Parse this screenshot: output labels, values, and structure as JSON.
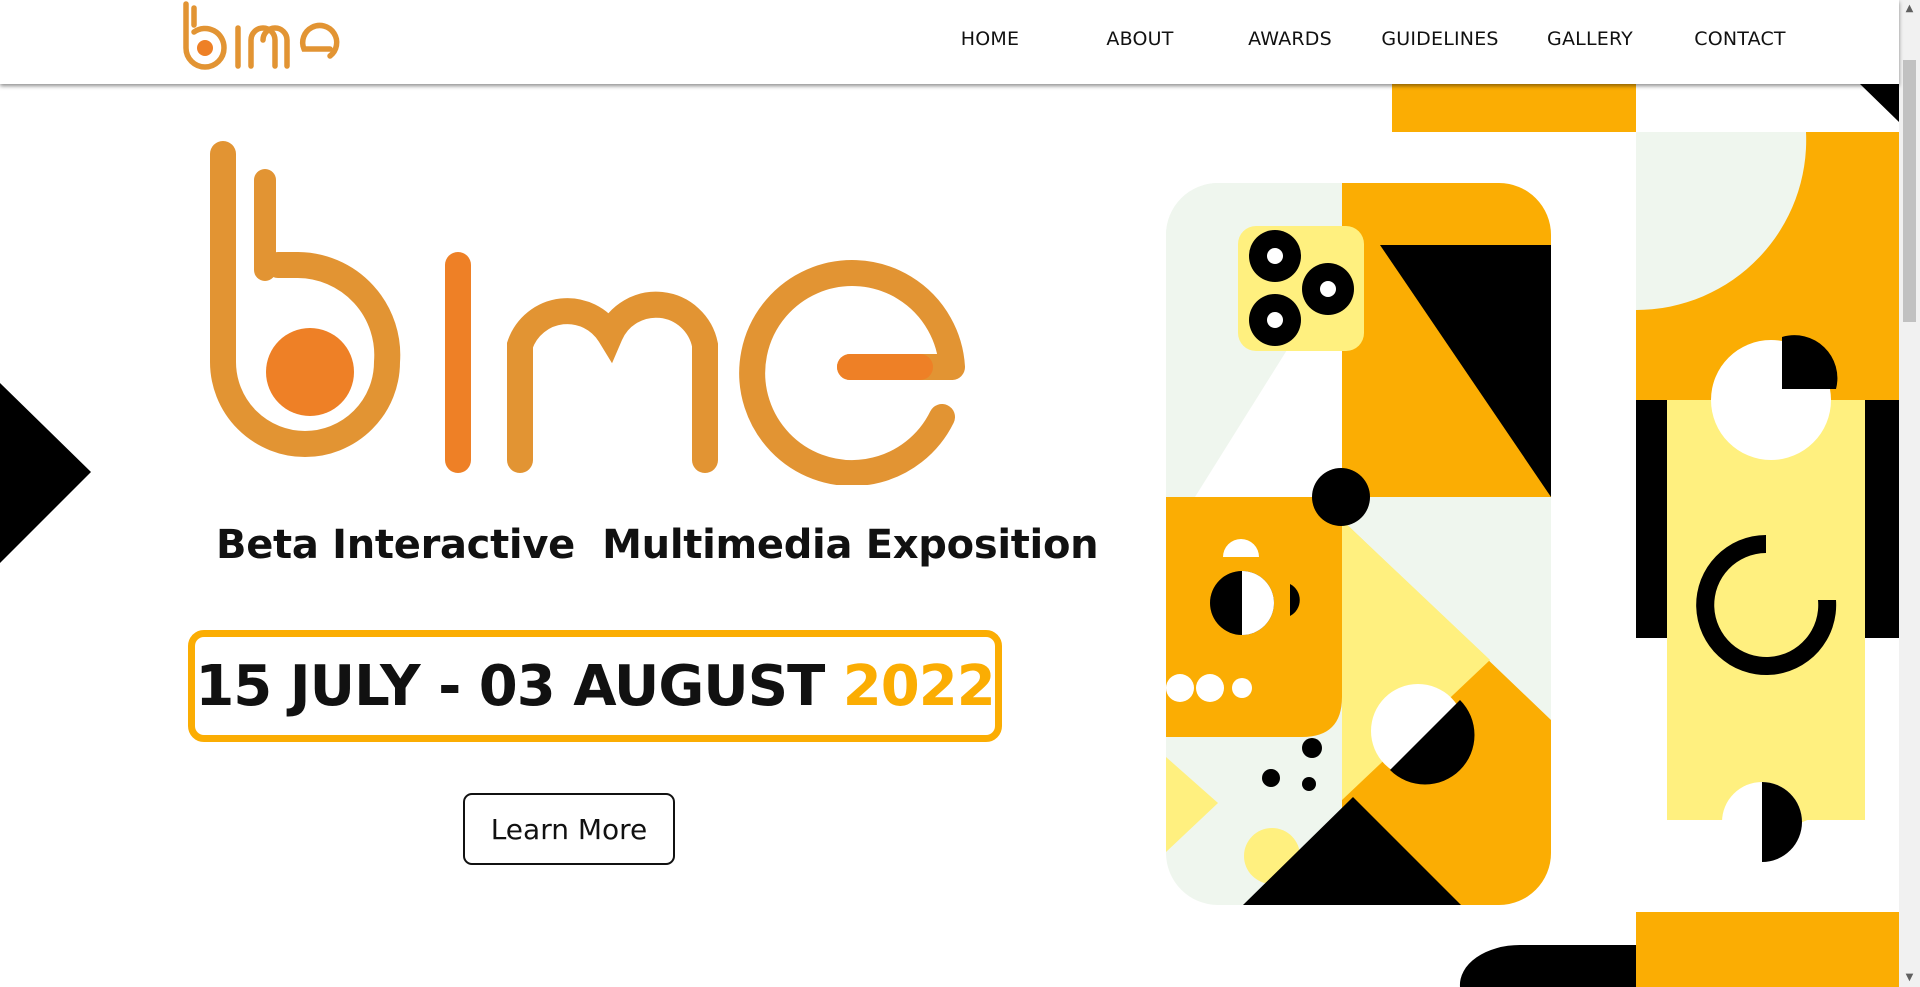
{
  "brand": {
    "logo_text": "bime",
    "color_primary": "#e29433",
    "color_accent": "#ee8026"
  },
  "nav": {
    "items": [
      {
        "label": "HOME"
      },
      {
        "label": "ABOUT"
      },
      {
        "label": "AWARDS"
      },
      {
        "label": "GUIDELINES"
      },
      {
        "label": "GALLERY"
      },
      {
        "label": "CONTACT"
      }
    ]
  },
  "hero": {
    "tagline": "Beta Interactive  Multimedia Exposition",
    "date_range": "15 JULY - 03 AUGUST ",
    "year": "2022",
    "cta_label": "Learn More"
  },
  "colors": {
    "yellow": "#fbad03",
    "light_yellow": "#fff07f",
    "mint": "#eff6ee",
    "black": "#000000"
  },
  "icons": {
    "left_arrow": "triangle-right-icon",
    "scroll_up": "scroll-up-arrow-icon",
    "scroll_down": "scroll-down-arrow-icon"
  }
}
